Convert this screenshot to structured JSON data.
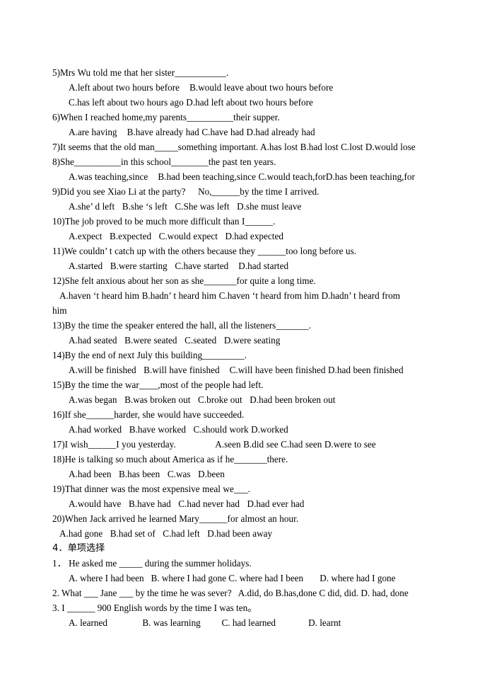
{
  "document": {
    "type": "english-grammar-worksheet",
    "background_color": "#ffffff",
    "text_color": "#000000"
  },
  "exercise_items": [
    {
      "stem": "5)Mrs Wu told me that her sister___________.",
      "option_lines": [
        "A.left about two hours before    B.would leave about two hours before",
        "C.has left about two hours ago D.had left about two hours before"
      ]
    },
    {
      "stem": "6)When I reached home,my parents__________their supper.",
      "option_lines": [
        "A.are having    B.have already had C.have had D.had already had"
      ]
    },
    {
      "stem": "7)It seems that the old man_____something important. A.has lost B.had lost C.lost D.would lose",
      "option_lines": []
    },
    {
      "stem": "8)She__________in this school________the past ten years.",
      "option_lines": [
        "A.was teaching,since    B.had been teaching,since C.would teach,forD.has been teaching,for"
      ]
    },
    {
      "stem": "9)Did you see Xiao Li at the party?     No,______by the time I arrived.",
      "option_lines": [
        "A.she’ d left   B.she ‘s left   C.She was left   D.she must leave"
      ]
    },
    {
      "stem": "10)The job proved to be much more difficult than I______.",
      "option_lines": [
        "A.expect   B.expected   C.would expect   D.had expected"
      ]
    },
    {
      "stem": "11)We couldn’ t catch up with the others because they ______too long before us.",
      "option_lines": [
        "A.started   B.were starting   C.have started    D.had started"
      ]
    },
    {
      "stem": "12)She felt anxious about her son as she_______for quite a long time.",
      "option_lines": [
        "A.haven ‘t heard him B.hadn’ t heard him C.haven ‘t heard from him D.hadn’ t heard from",
        "him"
      ]
    },
    {
      "stem": "13)By the time the speaker entered the hall, all the listeners_______.",
      "option_lines": [
        "A.had seated   B.were seated   C.seated   D.were seating"
      ]
    },
    {
      "stem": "14)By the end of next July this building_________.",
      "option_lines": [
        "A.will be finished   B.will have finished    C.will have been finished D.had been finished"
      ]
    },
    {
      "stem": "15)By the time the war____,most of the people had left.",
      "option_lines": [
        "A.was began   B.was broken out   C.broke out   D.had been broken out"
      ]
    },
    {
      "stem": "16)If she______harder, she would have succeeded.",
      "option_lines": [
        "A.had worked   B.have worked   C.should work D.worked"
      ]
    },
    {
      "stem": "17)I wish______I you yesterday.                A.seen B.did see C.had seen D.were to see",
      "option_lines": []
    },
    {
      "stem": "18)He is talking so much about America as if he_______there.",
      "option_lines": [
        "A.had been   B.has been   C.was   D.been"
      ]
    },
    {
      "stem": "19)That dinner was the most expensive meal we___.",
      "option_lines": [
        "A.would have   B.have had   C.had never had   D.had ever had"
      ]
    },
    {
      "stem": "20)When Jack arrived he learned Mary______for almost an hour.",
      "option_lines": [
        "A.had gone   B.had set of   C.had left   D.had been away"
      ]
    }
  ],
  "section": {
    "heading": "4．单项选择",
    "items": [
      {
        "stem": "1． He asked me _____ during the summer holidays.",
        "option_lines": [
          "A. where I had been   B. where I had gone C. where had I been       D. where had I gone"
        ]
      },
      {
        "stem": "2. What ___ Jane ___ by the time he was sever?   A.did, do B.has,done C did, did. D. had, done",
        "option_lines": []
      },
      {
        "stem": "3. I ______ 900 English words by the time I was ten。",
        "option_lines": [
          "A. learned               B. was learning         C. had learned              D. learnt"
        ]
      }
    ]
  }
}
